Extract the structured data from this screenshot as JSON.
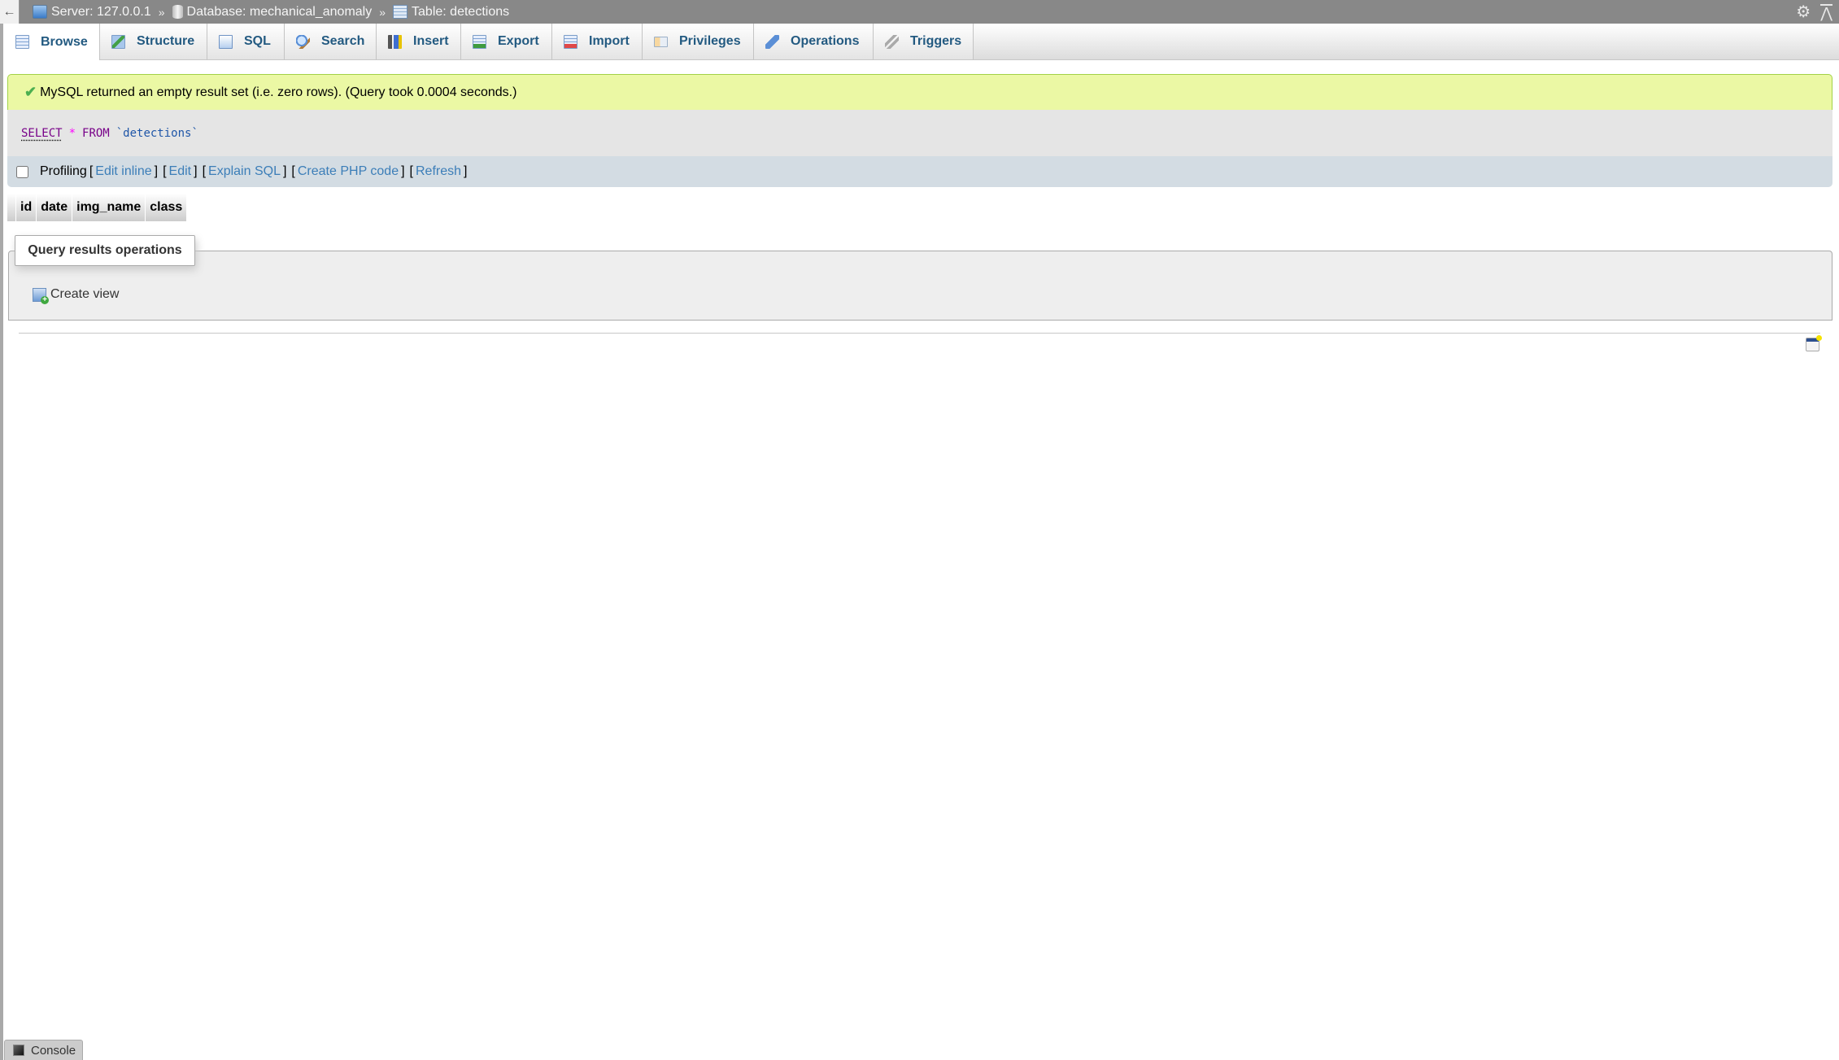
{
  "topbar": {
    "back_label": "←",
    "breadcrumbs": [
      {
        "icon": "server-icon",
        "label": "Server: 127.0.0.1"
      },
      {
        "icon": "database-icon",
        "label": "Database: mechanical_anomaly"
      },
      {
        "icon": "table-icon",
        "label": "Table: detections"
      }
    ],
    "separator": "»",
    "settings_icon": "⚙",
    "collapse_icon": "⋀"
  },
  "tabs": [
    {
      "label": "Browse",
      "icon": "browse-icon",
      "active": true
    },
    {
      "label": "Structure",
      "icon": "structure-icon"
    },
    {
      "label": "SQL",
      "icon": "sql-icon"
    },
    {
      "label": "Search",
      "icon": "search-icon"
    },
    {
      "label": "Insert",
      "icon": "insert-icon"
    },
    {
      "label": "Export",
      "icon": "export-icon"
    },
    {
      "label": "Import",
      "icon": "import-icon"
    },
    {
      "label": "Privileges",
      "icon": "privileges-icon"
    },
    {
      "label": "Operations",
      "icon": "operations-icon"
    },
    {
      "label": "Triggers",
      "icon": "triggers-icon"
    }
  ],
  "message": {
    "icon": "✔",
    "text": "MySQL returned an empty result set (i.e. zero rows). (Query took 0.0004 seconds.)"
  },
  "query": {
    "keyword_select": "SELECT",
    "star": "*",
    "keyword_from": "FROM",
    "table": "`detections`"
  },
  "profiling": {
    "checkbox_label": "Profiling",
    "checked": false,
    "links": [
      "Edit inline",
      "Edit",
      "Explain SQL",
      "Create PHP code",
      "Refresh"
    ],
    "open_bracket": "[",
    "close_bracket": "]"
  },
  "results": {
    "columns": [
      "id",
      "date",
      "img_name",
      "class"
    ],
    "rows": []
  },
  "operations": {
    "legend": "Query results operations",
    "create_view_label": "Create view"
  },
  "console": {
    "label": "Console"
  },
  "colors": {
    "topbar_bg": "#888888",
    "tab_text": "#235a81",
    "success_bg": "#ebf8a4",
    "success_border": "#a2d246",
    "sql_bg": "#e5e5e5",
    "profiling_bg": "#d3dce3",
    "link": "#3c7eb8",
    "sql_keyword": "#770088",
    "sql_operator": "#ff00ff",
    "sql_identifier": "#1f56a8"
  }
}
